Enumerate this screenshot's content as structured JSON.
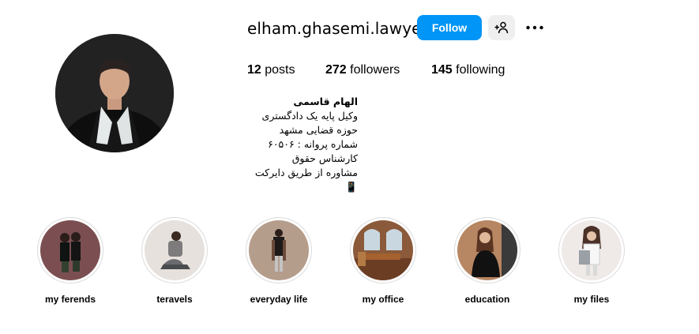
{
  "profile": {
    "username": "elham.ghasemi.lawyer",
    "follow_label": "Follow",
    "avatar_icon": "profile-photo",
    "suggest_icon": "person-add-icon",
    "more_icon": "more-horizontal-icon",
    "accent_color": "#0095f6"
  },
  "stats": {
    "posts_count": "12",
    "posts_label": "posts",
    "followers_count": "272",
    "followers_label": "followers",
    "following_count": "145",
    "following_label": "following"
  },
  "bio": {
    "name": "الهام قاسمی",
    "lines": [
      "وکیل پایه یک دادگستری",
      "حوزه قضایی مشهد",
      "شماره پروانه : ۶۰۵۰۶",
      "کارشناس حقوق",
      "مشاوره از طریق دایرکت 📱"
    ]
  },
  "highlights": [
    {
      "label": "my ferends"
    },
    {
      "label": "teravels"
    },
    {
      "label": "everyday life"
    },
    {
      "label": "my office"
    },
    {
      "label": "education"
    },
    {
      "label": "my files"
    }
  ]
}
